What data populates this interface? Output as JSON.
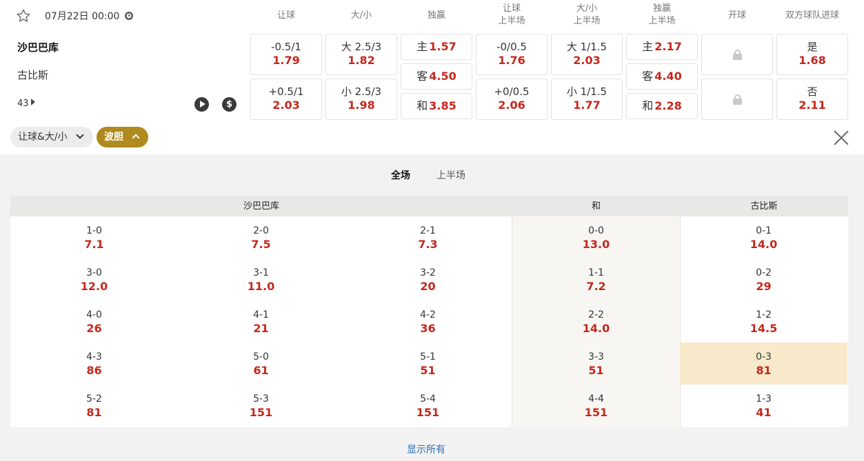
{
  "match": {
    "date_time": "07月22日 00:00",
    "home_team": "沙巴巴库",
    "away_team": "古比斯",
    "more_markets_count": "43"
  },
  "icons": [
    "star-icon",
    "clock-icon",
    "play-icon",
    "dollar-icon",
    "lock-icon",
    "chevron-down-icon",
    "chevron-up-icon",
    "close-icon"
  ],
  "columns": {
    "handicap": "让球",
    "over_under": "大/小",
    "moneyline": "独赢",
    "handicap_1h": [
      "让球",
      "上半场"
    ],
    "over_under_1h": [
      "大/小",
      "上半场"
    ],
    "moneyline_1h": [
      "独赢",
      "上半场"
    ],
    "kickoff": "开球",
    "btts": "双方球队进球"
  },
  "odds": {
    "handicap": [
      {
        "line": "-0.5/1",
        "odd": "1.79"
      },
      {
        "line": "+0.5/1",
        "odd": "2.03"
      }
    ],
    "over_under": [
      {
        "line": "大 2.5/3",
        "odd": "1.82"
      },
      {
        "line": "小 2.5/3",
        "odd": "1.98"
      }
    ],
    "moneyline": [
      {
        "label": "主",
        "odd": "1.57"
      },
      {
        "label": "客",
        "odd": "4.50"
      },
      {
        "label": "和",
        "odd": "3.85"
      }
    ],
    "handicap_1h": [
      {
        "line": "-0/0.5",
        "odd": "1.76"
      },
      {
        "line": "+0/0.5",
        "odd": "2.06"
      }
    ],
    "over_under_1h": [
      {
        "line": "大 1/1.5",
        "odd": "2.03"
      },
      {
        "line": "小 1/1.5",
        "odd": "1.77"
      }
    ],
    "moneyline_1h": [
      {
        "label": "主",
        "odd": "2.17"
      },
      {
        "label": "客",
        "odd": "4.40"
      },
      {
        "label": "和",
        "odd": "2.28"
      }
    ],
    "btts": [
      {
        "label": "是",
        "odd": "1.68"
      },
      {
        "label": "否",
        "odd": "2.11"
      }
    ]
  },
  "filters": {
    "chip1": "让球&大/小",
    "chip2": "波胆"
  },
  "period_tabs": [
    "全场",
    "上半场"
  ],
  "correct_score": {
    "headers": {
      "home": "沙巴巴库",
      "draw": "和",
      "away": "古比斯"
    },
    "home": [
      [
        {
          "s": "1-0",
          "o": "7.1"
        },
        {
          "s": "3-0",
          "o": "12.0"
        },
        {
          "s": "4-0",
          "o": "26"
        },
        {
          "s": "4-3",
          "o": "86"
        },
        {
          "s": "5-2",
          "o": "81"
        }
      ],
      [
        {
          "s": "2-0",
          "o": "7.5"
        },
        {
          "s": "3-1",
          "o": "11.0"
        },
        {
          "s": "4-1",
          "o": "21"
        },
        {
          "s": "5-0",
          "o": "61"
        },
        {
          "s": "5-3",
          "o": "151"
        }
      ],
      [
        {
          "s": "2-1",
          "o": "7.3"
        },
        {
          "s": "3-2",
          "o": "20"
        },
        {
          "s": "4-2",
          "o": "36"
        },
        {
          "s": "5-1",
          "o": "51"
        },
        {
          "s": "5-4",
          "o": "151"
        }
      ]
    ],
    "draw": [
      {
        "s": "0-0",
        "o": "13.0"
      },
      {
        "s": "1-1",
        "o": "7.2"
      },
      {
        "s": "2-2",
        "o": "14.0"
      },
      {
        "s": "3-3",
        "o": "51"
      },
      {
        "s": "4-4",
        "o": "151"
      }
    ],
    "away": [
      {
        "s": "0-1",
        "o": "14.0"
      },
      {
        "s": "0-2",
        "o": "29"
      },
      {
        "s": "1-2",
        "o": "14.5"
      },
      {
        "s": "0-3",
        "o": "81",
        "highlighted": true
      },
      {
        "s": "1-3",
        "o": "41"
      }
    ],
    "highlight_color": "#f8e9cb"
  },
  "show_all": "显示所有",
  "colors": {
    "odd": "#c8261b",
    "accent_chip": "#b08a1e",
    "link": "#2d6db5"
  }
}
